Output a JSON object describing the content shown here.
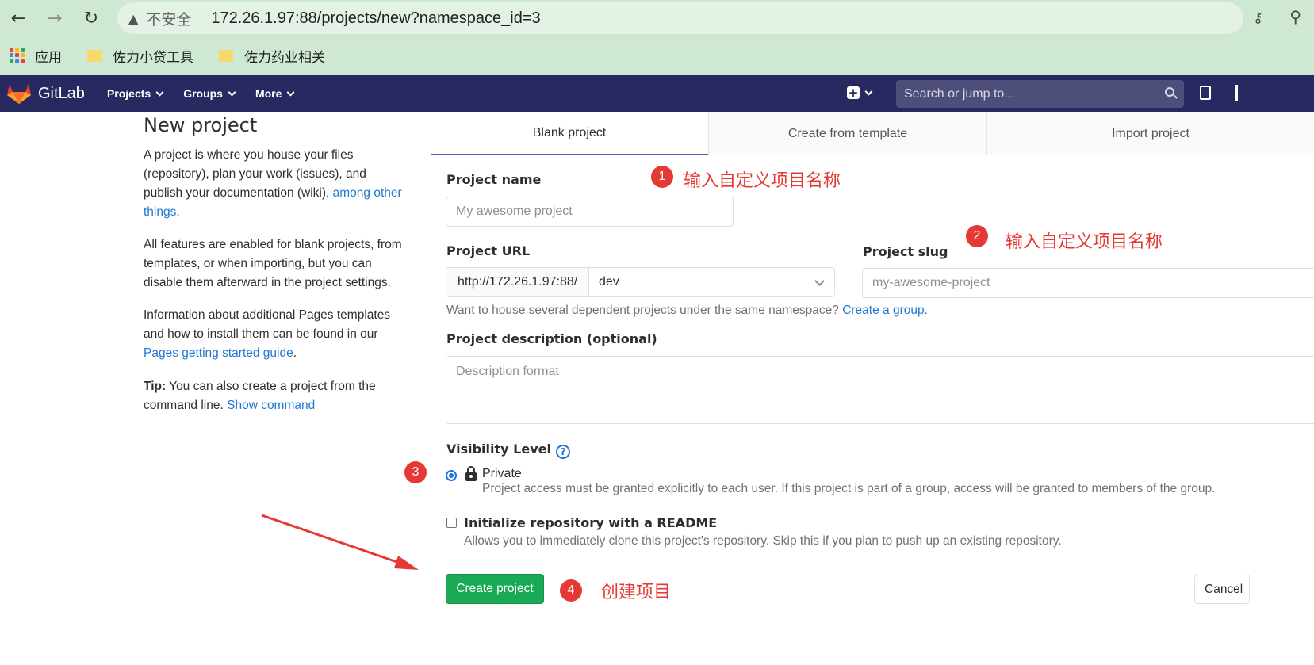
{
  "browser": {
    "insecure_label": "不安全",
    "url": "172.26.1.97:88/projects/new?namespace_id=3",
    "bookmarks": [
      "应用",
      "佐力小贷工具",
      "佐力药业相关"
    ]
  },
  "navbar": {
    "brand": "GitLab",
    "menus": [
      "Projects",
      "Groups",
      "More"
    ],
    "search_placeholder": "Search or jump to..."
  },
  "intro": {
    "title": "New project",
    "p1": "A project is where you house your files (repository), plan your work (issues), and publish your documentation (wiki), ",
    "p1_link": "among other things",
    "p1_end": ".",
    "p2": "All features are enabled for blank projects, from templates, or when importing, but you can disable them afterward in the project settings.",
    "p3": "Information about additional Pages templates and how to install them can be found in our ",
    "p3_link": "Pages getting started guide",
    "p3_end": ".",
    "tip_label": "Tip:",
    "tip": " You can also create a project from the command line. ",
    "tip_link": "Show command"
  },
  "tabs": [
    "Blank project",
    "Create from template",
    "Import project"
  ],
  "form": {
    "project_name_label": "Project name",
    "project_name_placeholder": "My awesome project",
    "project_url_label": "Project URL",
    "url_prefix": "http://172.26.1.97:88/",
    "namespace": "dev",
    "slug_label": "Project slug",
    "slug_placeholder": "my-awesome-project",
    "group_help": "Want to house several dependent projects under the same namespace? ",
    "group_link": "Create a group.",
    "description_label": "Project description (optional)",
    "description_placeholder": "Description format",
    "visibility_label": "Visibility Level",
    "private_label": "Private",
    "private_help": "Project access must be granted explicitly to each user. If this project is part of a group, access will be granted to members of the group.",
    "readme_label": "Initialize repository with a README",
    "readme_help": "Allows you to immediately clone this project's repository. Skip this if you plan to push up an existing repository.",
    "create_button": "Create project",
    "cancel_button": "Cancel"
  },
  "annotations": [
    {
      "num": "1",
      "text": "输入自定义项目名称"
    },
    {
      "num": "2",
      "text": "输入自定义项目名称"
    },
    {
      "num": "3",
      "text": ""
    },
    {
      "num": "4",
      "text": "创建项目"
    }
  ],
  "colors": {
    "navbar": "#292961",
    "primary_button": "#1aaa55",
    "link": "#1f78d1",
    "annotation": "#e53935"
  }
}
